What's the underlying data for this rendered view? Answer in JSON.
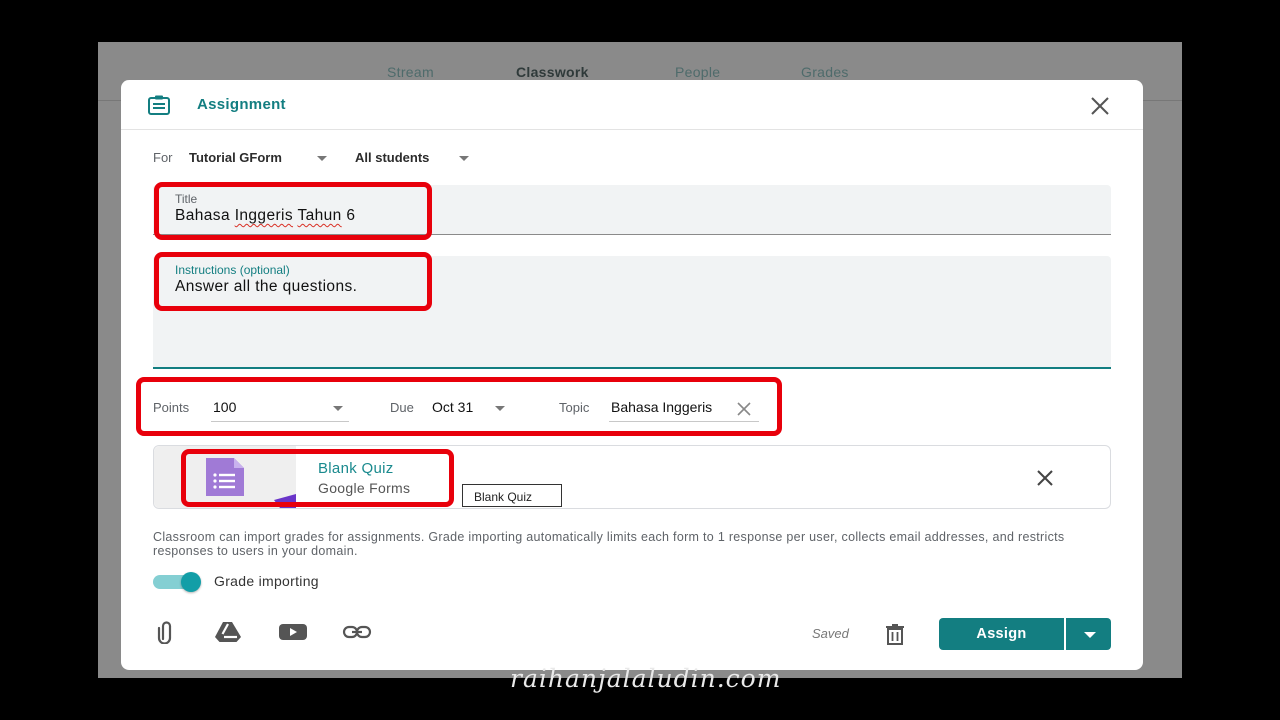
{
  "nav_tabs": [
    "Stream",
    "Classwork",
    "People",
    "Grades"
  ],
  "dialog": {
    "title": "Assignment",
    "for_label": "For",
    "class_name": "Tutorial GForm",
    "students": "All students"
  },
  "title_field": {
    "label": "Title",
    "value_plain": "Bahasa ",
    "value_misspelled1": "Inggeris",
    "value_misspelled2": "Tahun",
    "value_end": " 6"
  },
  "instructions_field": {
    "label": "Instructions (optional)",
    "value": "Answer all the questions."
  },
  "points": {
    "label": "Points",
    "value": "100"
  },
  "due": {
    "label": "Due",
    "value": "Oct 31"
  },
  "topic": {
    "label": "Topic",
    "value": "Bahasa Inggeris"
  },
  "attachment": {
    "title": "Blank Quiz",
    "subtitle": "Google Forms",
    "tooltip": "Blank Quiz"
  },
  "info_text": "Classroom can import grades for assignments. Grade importing automatically limits each form to 1 response per user, collects email addresses, and restricts responses to users in your domain.",
  "grade_importing": {
    "label": "Grade importing",
    "enabled": true
  },
  "footer": {
    "saved": "Saved",
    "assign": "Assign"
  },
  "watermark": "raihanjalaludin.com",
  "colors": {
    "accent": "#137e81",
    "highlight": "#e8000b",
    "forms_purple": "#a07ad6"
  }
}
